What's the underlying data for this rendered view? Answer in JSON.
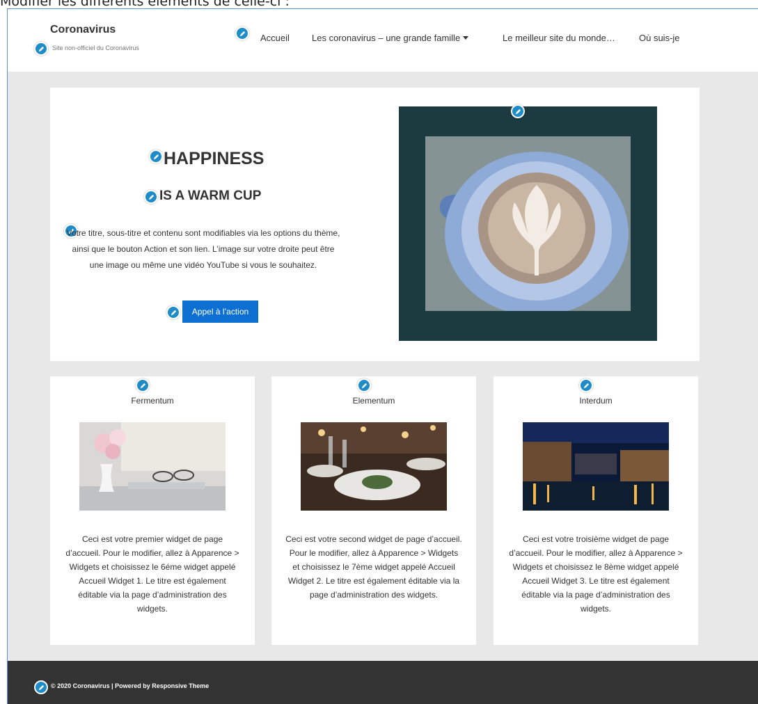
{
  "top_caption": "Modifier les différents éléments de celle-ci :",
  "header": {
    "site_title": "Coronavirus",
    "site_description": "Site non-officiel du Coronavirus",
    "nav": [
      {
        "label": "Accueil"
      },
      {
        "label": "Les coronavirus – une grande famille"
      },
      {
        "label": "Le meilleur site du monde…"
      },
      {
        "label": "Où suis-je"
      }
    ]
  },
  "hero": {
    "title": "HAPPINESS",
    "subtitle": "IS A WARM CUP",
    "text": "Votre titre, sous-titre et contenu sont modifiables via les options du thème, ainsi que le bouton Action et son lien. L’image sur votre droite peut être une image ou même une vidéo YouTube si vous le souhaitez.",
    "button_label": "Appel à l’action"
  },
  "widgets": [
    {
      "title": "Fermentum",
      "text": "Ceci est votre premier widget de page d’accueil. Pour le modifier, allez à Apparence > Widgets et choisissez le 6éme widget appelé Accueil Widget 1. Le titre est également éditable via la page d’administration des widgets."
    },
    {
      "title": "Elementum",
      "text": "Ceci est votre second widget de page d’accueil. Pour le modifier, allez à Apparence > Widgets et choisissez le 7ème widget appelé Accueil Widget 2. Le titre est également éditable via la page d’administration des widgets."
    },
    {
      "title": "Interdum",
      "text": "Ceci est votre troisième widget de page d’accueil. Pour le modifier, allez à Apparence > Widgets et choisissez le 8ème widget appelé Accueil Widget 3. Le titre est également éditable via la page d’administration des widgets."
    }
  ],
  "footer": {
    "text": "© 2020 Coronavirus | Powered by Responsive Theme"
  },
  "colors": {
    "accent": "#0d6fd1",
    "edit_icon": "#1e8cc8",
    "footer_bg": "#333333",
    "page_bg": "#e8e8e8"
  },
  "icons": {
    "edit": "pencil-icon"
  }
}
